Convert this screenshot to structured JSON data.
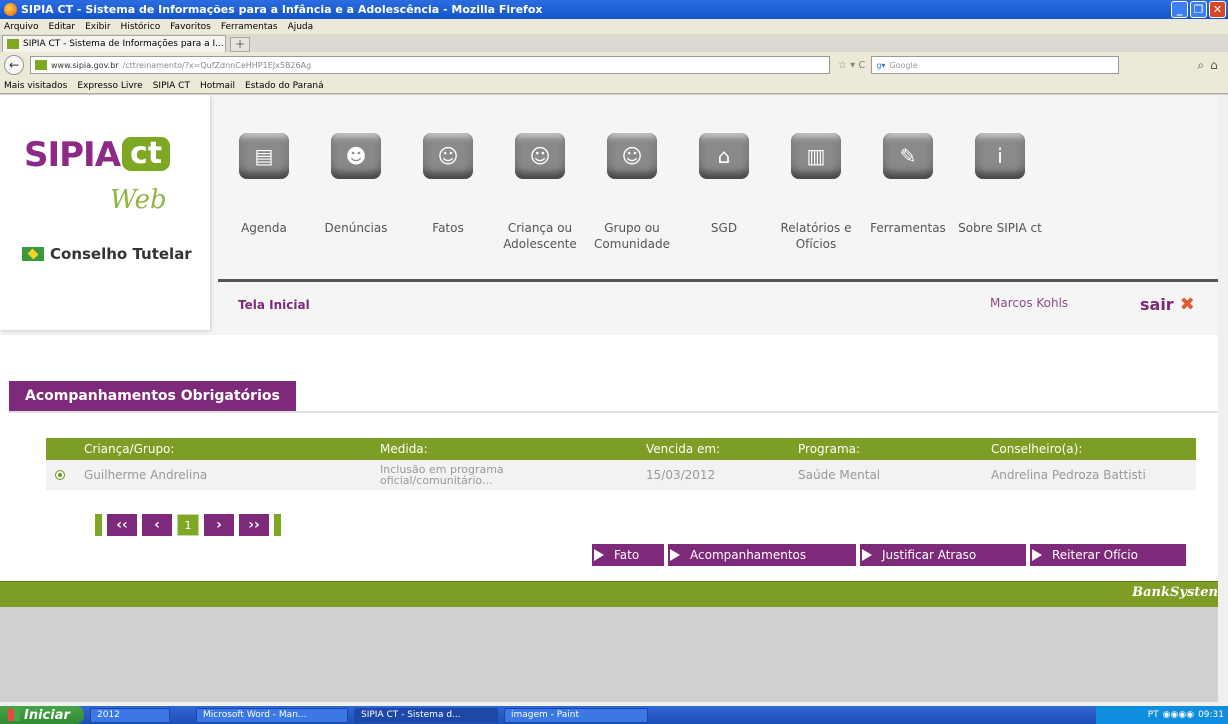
{
  "window": {
    "title": "SIPIA CT - Sistema de Informações para a Infância e a Adolescência - Mozilla Firefox"
  },
  "menu": [
    "Arquivo",
    "Editar",
    "Exibir",
    "Histórico",
    "Favoritos",
    "Ferramentas",
    "Ajuda"
  ],
  "tab": {
    "label": "SIPIA CT - Sistema de Informações para a I...",
    "plus": "+"
  },
  "address": {
    "url_domain": "www.sipia.gov.br",
    "url_path": "/cttreinamento/?x=QufZdnnCeHHP1EJx5B26Ag",
    "search_placeholder": "Google"
  },
  "bookmarks": [
    "Mais visitados",
    "Expresso Livre",
    "SIPIA CT",
    "Hotmail",
    "Estado do Paraná"
  ],
  "logo": {
    "sipia": "SIPIA",
    "ct": "ct",
    "web": "Web",
    "org": "Conselho Tutelar"
  },
  "nav": [
    {
      "label": "Agenda",
      "icon": "agenda-icon",
      "glyph": "▤"
    },
    {
      "label": "Denúncias",
      "icon": "denuncias-icon",
      "glyph": "☻"
    },
    {
      "label": "Fatos",
      "icon": "fatos-icon",
      "glyph": "☺"
    },
    {
      "label": "Criança ou Adolescente",
      "icon": "crianca-icon",
      "glyph": "☺"
    },
    {
      "label": "Grupo ou Comunidade",
      "icon": "grupo-icon",
      "glyph": "☺"
    },
    {
      "label": "SGD",
      "icon": "home-icon",
      "glyph": "⌂"
    },
    {
      "label": "Relatórios e Ofícios",
      "icon": "relatorios-icon",
      "glyph": "▥"
    },
    {
      "label": "Ferramentas",
      "icon": "ferramentas-icon",
      "glyph": "✎"
    },
    {
      "label": "Sobre SIPIA ct",
      "icon": "info-icon",
      "glyph": "i"
    }
  ],
  "breadcrumb": "Tela Inicial",
  "user": "Marcos Kohls",
  "logout": "sair",
  "section": {
    "title": "Acompanhamentos Obrigatórios"
  },
  "table": {
    "headers": [
      "Criança/Grupo:",
      "Medida:",
      "Vencida em:",
      "Programa:",
      "Conselheiro(a):"
    ],
    "row": {
      "crianca": "Guilherme Andrelina",
      "medida": "Inclusão em programa oficial/comunitário...",
      "vencida": "15/03/2012",
      "programa": "Saúde Mental",
      "conselheiro": "Andrelina Pedroza Battisti"
    }
  },
  "pager": {
    "first": "‹‹",
    "prev": "‹",
    "page": "1",
    "next": "›",
    "last": "››"
  },
  "actions": [
    "Fato",
    "Acompanhamentos",
    "Justificar Atraso",
    "Reiterar Ofício"
  ],
  "footer": {
    "brand": "BankSysten"
  },
  "taskbar": {
    "start": "Iniciar",
    "tasks": [
      "2012",
      "Microsoft Word - Man...",
      "SIPIA CT - Sistema d...",
      "imagem - Paint"
    ],
    "lang": "PT",
    "clock": "09:31"
  },
  "colors": {
    "purple": "#7e2a7b",
    "green": "#7e9d24"
  }
}
